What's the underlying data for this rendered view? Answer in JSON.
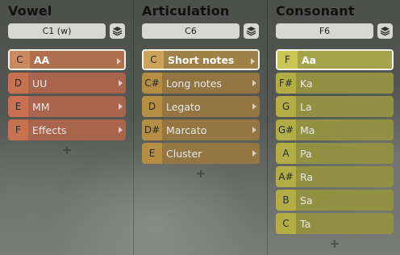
{
  "columns": [
    {
      "title": "Vowel",
      "selector": "C1 (w)",
      "plus": "+",
      "items": [
        {
          "note": "C",
          "label": "AA",
          "selected": true,
          "submenu": true
        },
        {
          "note": "D",
          "label": "UU",
          "submenu": true
        },
        {
          "note": "E",
          "label": "MM",
          "submenu": true
        },
        {
          "note": "F",
          "label": "Effects",
          "submenu": true
        }
      ]
    },
    {
      "title": "Articulation",
      "selector": "C6",
      "plus": "+",
      "items": [
        {
          "note": "C",
          "label": "Short notes",
          "selected": true,
          "submenu": true
        },
        {
          "note": "C#",
          "label": "Long notes",
          "submenu": true
        },
        {
          "note": "D",
          "label": "Legato",
          "submenu": true
        },
        {
          "note": "D#",
          "label": "Marcato",
          "submenu": true
        },
        {
          "note": "E",
          "label": "Cluster",
          "submenu": true
        }
      ]
    },
    {
      "title": "Consonant",
      "selector": "F6",
      "plus": "+",
      "items": [
        {
          "note": "F",
          "label": "Aa",
          "selected": true
        },
        {
          "note": "F#",
          "label": "Ka"
        },
        {
          "note": "G",
          "label": "La"
        },
        {
          "note": "G#",
          "label": "Ma"
        },
        {
          "note": "A",
          "label": "Pa"
        },
        {
          "note": "A#",
          "label": "Ra"
        },
        {
          "note": "B",
          "label": "Sa"
        },
        {
          "note": "C",
          "label": "Ta"
        }
      ]
    }
  ],
  "icons": {
    "stack": "layers-icon",
    "arrow": "chevron-right-icon",
    "plus": "plus-icon"
  }
}
